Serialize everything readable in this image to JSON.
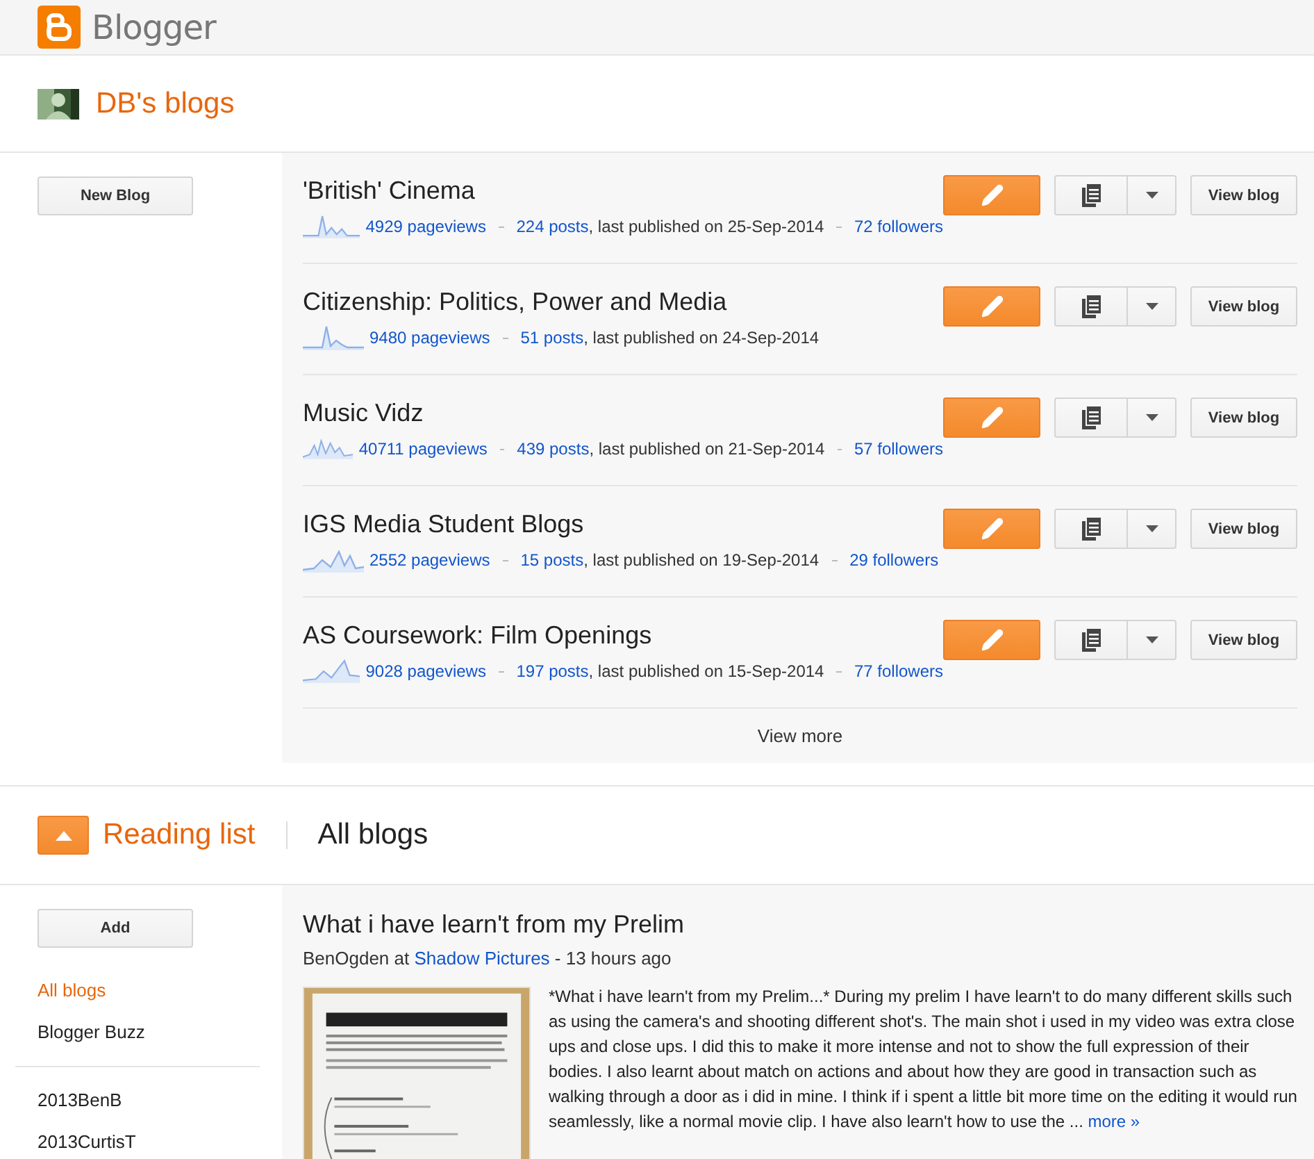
{
  "app": {
    "name": "Blogger"
  },
  "blogs_section": {
    "title": "DB's blogs",
    "new_button": "New Blog",
    "view_more": "View more",
    "blogs": [
      {
        "title": "'British' Cinema",
        "pageviews": "4929 pageviews",
        "posts": "224 posts",
        "published": ", last published on 25-Sep-2014",
        "followers": "72 followers",
        "view_button": "View blog"
      },
      {
        "title": "Citizenship: Politics, Power and Media",
        "pageviews": "9480 pageviews",
        "posts": "51 posts",
        "published": ", last published on 24-Sep-2014",
        "view_button": "View blog"
      },
      {
        "title": "Music Vidz",
        "pageviews": "40711 pageviews",
        "posts": "439 posts",
        "published": ", last published on 21-Sep-2014",
        "followers": "57 followers",
        "view_button": "View blog"
      },
      {
        "title": "IGS Media Student Blogs",
        "pageviews": "2552 pageviews",
        "posts": "15 posts",
        "published": ", last published on 19-Sep-2014",
        "followers": "29 followers",
        "view_button": "View blog"
      },
      {
        "title": "AS Coursework: Film Openings",
        "pageviews": "9028 pageviews",
        "posts": "197 posts",
        "published": ", last published on 15-Sep-2014",
        "followers": "77 followers",
        "view_button": "View blog"
      }
    ]
  },
  "reading_list": {
    "title": "Reading list",
    "subtitle": "All blogs",
    "add_button": "Add",
    "filters": [
      {
        "label": "All blogs",
        "selected": true
      },
      {
        "label": "Blogger Buzz",
        "selected": false
      }
    ],
    "followed": [
      {
        "label": "2013BenB",
        "selected": false
      },
      {
        "label": "2013CurtisT",
        "selected": false
      }
    ],
    "posts": [
      {
        "title": "What i have learn't from my Prelim",
        "author": "BenOgden at",
        "blog": "Shadow Pictures",
        "time": " - 13 hours ago",
        "excerpt": "*What i have learn't from my Prelim...* During my prelim I have learn't to do many different skills such as using the camera's and shooting different shot's. The main shot i used in my video was extra close ups and close ups. I did this to make it more intense and not to show the full expression of their bodies. I also learnt about match on actions and about how they are good in transaction such as walking through a door as i did in mine. I think if i spent a little bit more time on the editing it would run seamlessly, like a normal movie clip. I have also learn't how to use the ... ",
        "more": "more »"
      }
    ]
  }
}
